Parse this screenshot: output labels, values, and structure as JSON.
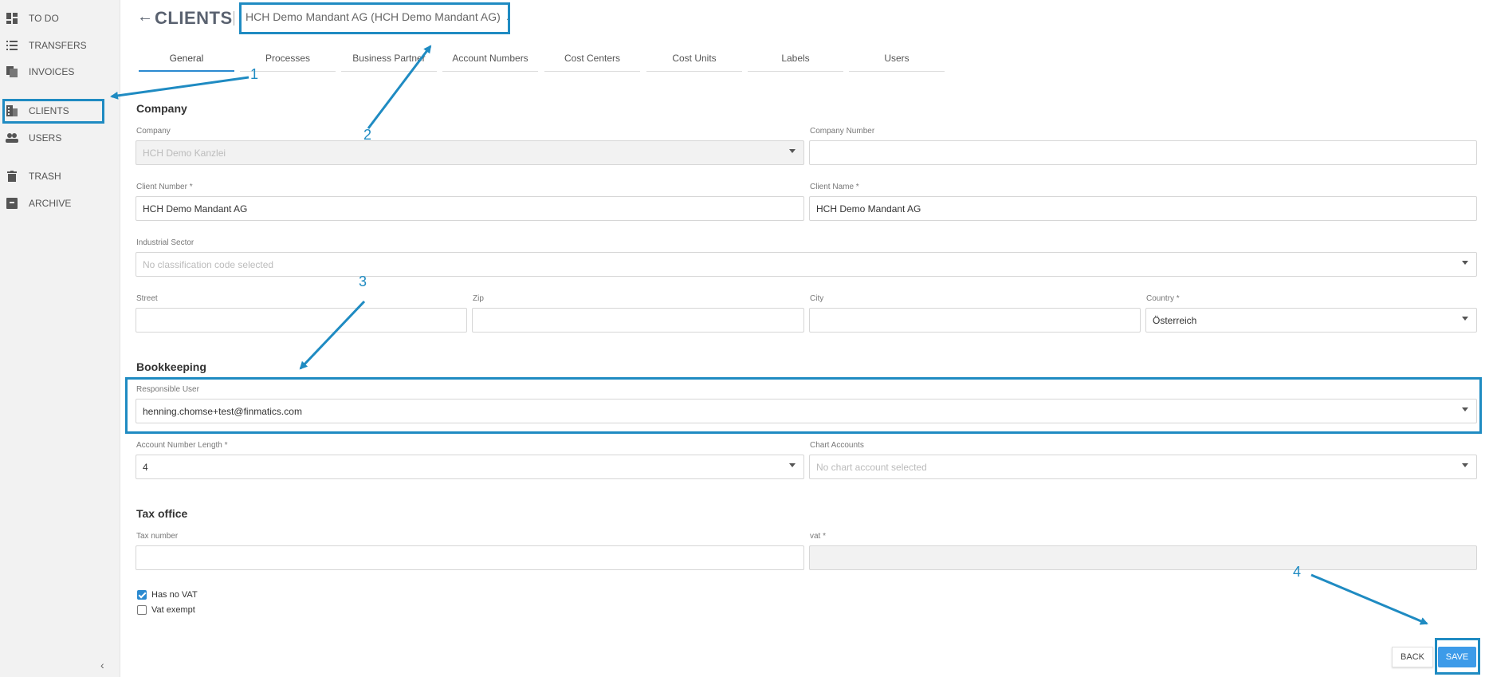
{
  "sidebar": {
    "items": [
      {
        "label": "TO DO",
        "icon": "dashboard-icon"
      },
      {
        "label": "TRANSFERS",
        "icon": "list-icon"
      },
      {
        "label": "INVOICES",
        "icon": "documents-icon"
      },
      {
        "label": "CLIENTS",
        "icon": "building-icon"
      },
      {
        "label": "USERS",
        "icon": "users-icon"
      },
      {
        "label": "TRASH",
        "icon": "trash-icon"
      },
      {
        "label": "ARCHIVE",
        "icon": "archive-icon"
      }
    ],
    "collapse_glyph": "‹"
  },
  "header": {
    "back_glyph": "←",
    "title": "CLIENTS",
    "client_selector": "HCH Demo Mandant AG (HCH Demo Mandant AG)",
    "chevron_glyph": "⌄"
  },
  "tabs": [
    "General",
    "Processes",
    "Business Partner",
    "Account Numbers",
    "Cost Centers",
    "Cost Units",
    "Labels",
    "Users"
  ],
  "company": {
    "section_title": "Company",
    "company_label": "Company",
    "company_value": "HCH Demo Kanzlei",
    "company_number_label": "Company Number",
    "company_number_value": "",
    "client_number_label": "Client Number *",
    "client_number_value": "HCH Demo Mandant AG",
    "client_name_label": "Client Name *",
    "client_name_value": "HCH Demo Mandant AG",
    "industrial_sector_label": "Industrial Sector",
    "industrial_sector_placeholder": "No classification code selected",
    "street_label": "Street",
    "zip_label": "Zip",
    "city_label": "City",
    "country_label": "Country *",
    "country_value": "Österreich"
  },
  "bookkeeping": {
    "section_title": "Bookkeeping",
    "responsible_user_label": "Responsible User",
    "responsible_user_value": "henning.chomse+test@finmatics.com",
    "account_number_length_label": "Account Number Length *",
    "account_number_length_value": "4",
    "chart_accounts_label": "Chart Accounts",
    "chart_accounts_placeholder": "No chart account selected"
  },
  "tax_office": {
    "section_title": "Tax office",
    "tax_number_label": "Tax number",
    "vat_label": "vat *",
    "has_no_vat_label": "Has no VAT",
    "has_no_vat_checked": true,
    "vat_exempt_label": "Vat exempt",
    "vat_exempt_checked": false
  },
  "actions": {
    "back_label": "BACK",
    "save_label": "SAVE"
  },
  "annotations": {
    "color": "#1f8bc2",
    "numbers": [
      "1",
      "2",
      "3",
      "4"
    ]
  },
  "colors": {
    "accent": "#2b8ad0",
    "save_button": "#3d9be9"
  }
}
